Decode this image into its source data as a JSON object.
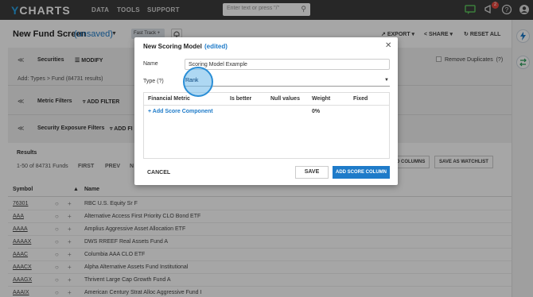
{
  "app": {
    "logo_prefix": "Y",
    "logo_rest": "CHARTS",
    "nav": [
      "DATA",
      "TOOLS",
      "SUPPORT"
    ],
    "search_placeholder": "Enter text or press \"/\"",
    "notification_count": "2"
  },
  "header": {
    "title": "New Fund Screen",
    "status": "(unsaved)",
    "fast_track": "Fast Track",
    "actions": [
      "EXPORT",
      "SHARE",
      "RESET ALL"
    ]
  },
  "panels": {
    "securities_label": "Securities",
    "modify_label": "MODIFY",
    "types_text": "Add: Types > Fund (84731 results)",
    "remove_duplicates": "Remove Duplicates",
    "help": "(?)",
    "metric_filters_label": "Metric Filters",
    "add_filter": "ADD FILTER",
    "exposure_label": "Security Exposure Filters",
    "add_filter_trunc": "ADD FI"
  },
  "results": {
    "title": "Results",
    "count": "1-50 of 84731 Funds",
    "first": "FIRST",
    "prev": "PREV",
    "next_trunc": "N",
    "columns_btn": "D COLUMNS",
    "watchlist_btn": "SAVE AS WATCHLIST",
    "col_symbol": "Symbol",
    "col_name": "Name",
    "rows": [
      {
        "symbol": "76301",
        "name": "RBC U.S. Equity Sr F"
      },
      {
        "symbol": "AAA",
        "name": "Alternative Access First Priority CLO Bond ETF"
      },
      {
        "symbol": "AAAA",
        "name": "Amplius Aggressive Asset Allocation ETF"
      },
      {
        "symbol": "AAAAX",
        "name": "DWS RREEF Real Assets Fund A"
      },
      {
        "symbol": "AAAC",
        "name": "Columbia AAA CLO ETF"
      },
      {
        "symbol": "AAACX",
        "name": "Alpha Alternative Assets Fund Institutional"
      },
      {
        "symbol": "AAAGX",
        "name": "Thrivent Large Cap Growth Fund A"
      },
      {
        "symbol": "AAAIX",
        "name": "American Century Strat Alloc Aggressive Fund I"
      }
    ]
  },
  "modal": {
    "title": "New Scoring Model",
    "edited": "(edited)",
    "name_label": "Name",
    "name_value": "Scoring Model Example",
    "type_label": "Type",
    "type_help": "(?)",
    "type_value": "Rank",
    "col_metric": "Financial Metric",
    "col_better": "Is better",
    "col_null": "Null values",
    "col_weight": "Weight",
    "col_fixed": "Fixed",
    "add_component": "+ Add Score Component",
    "weight_total": "0%",
    "cancel": "CANCEL",
    "save": "SAVE",
    "add_score_column": "ADD SCORE COLUMN"
  }
}
